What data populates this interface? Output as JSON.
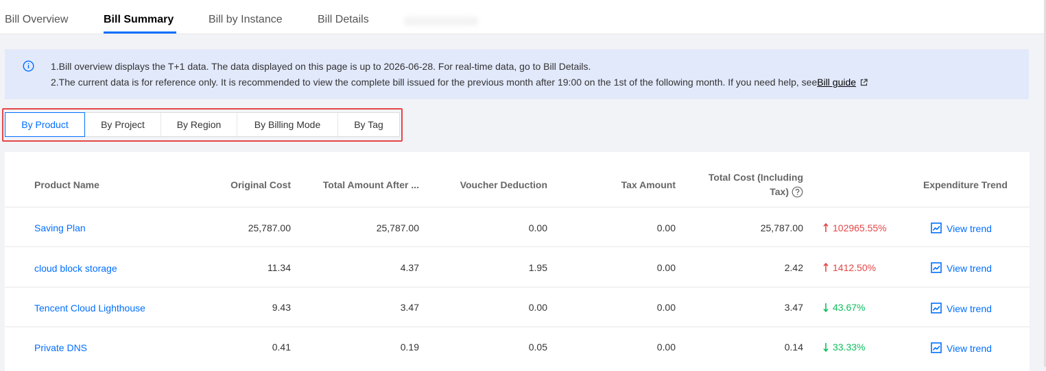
{
  "tabs": {
    "overview": "Bill Overview",
    "summary": "Bill Summary",
    "instance": "Bill by Instance",
    "details": "Bill Details"
  },
  "notice": {
    "line1": "1.Bill overview displays the T+1 data. The data displayed on this page is up to 2026-06-28. For real-time data, go to Bill Details.",
    "line2_prefix": "2.The current data is for reference only. It is recommended to view the complete bill issued for the previous month after 19:00 on the 1st of the following month. If you need help, see",
    "line2_link": "Bill guide"
  },
  "segments": [
    "By Product",
    "By Project",
    "By Region",
    "By Billing Mode",
    "By Tag"
  ],
  "table": {
    "headers": {
      "product": "Product Name",
      "original": "Original Cost",
      "after": "Total Amount After ...",
      "voucher": "Voucher Deduction",
      "tax": "Tax Amount",
      "total_l1": "Total Cost (Including",
      "total_l2": "Tax)",
      "trend": "Expenditure Trend"
    },
    "rows": [
      {
        "product": "Saving Plan",
        "original": "25,787.00",
        "after": "25,787.00",
        "voucher": "0.00",
        "tax": "0.00",
        "total": "25,787.00",
        "change": "102965.55%",
        "dir": "up",
        "action": "View trend"
      },
      {
        "product": "cloud block storage",
        "original": "11.34",
        "after": "4.37",
        "voucher": "1.95",
        "tax": "0.00",
        "total": "2.42",
        "change": "1412.50%",
        "dir": "up",
        "action": "View trend"
      },
      {
        "product": "Tencent Cloud Lighthouse",
        "original": "9.43",
        "after": "3.47",
        "voucher": "0.00",
        "tax": "0.00",
        "total": "3.47",
        "change": "43.67%",
        "dir": "down",
        "action": "View trend"
      },
      {
        "product": "Private DNS",
        "original": "0.41",
        "after": "0.19",
        "voucher": "0.05",
        "tax": "0.00",
        "total": "0.14",
        "change": "33.33%",
        "dir": "down",
        "action": "View trend"
      }
    ]
  },
  "colors": {
    "accent": "#006eff",
    "up": "#e54545",
    "down": "#0abf5b",
    "highlight_border": "#e54545"
  }
}
